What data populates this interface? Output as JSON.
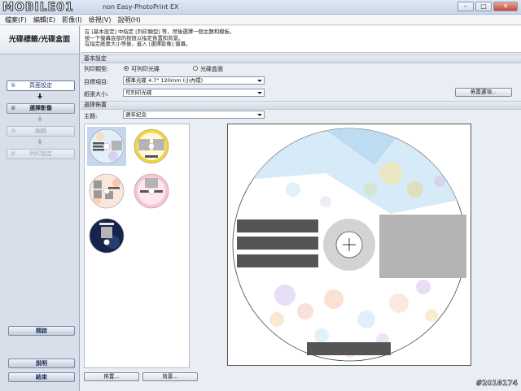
{
  "window": {
    "logo": "MOBILE01",
    "title": "non Easy-PhotoPrint EX",
    "controls": [
      "–",
      "□",
      "✕"
    ]
  },
  "menu": [
    "檔案(F)",
    "編輯(E)",
    "影像(I)",
    "檢視(V)",
    "說明(H)"
  ],
  "sidebar": {
    "title": "光碟標籤/光碟盒面",
    "steps": [
      {
        "num": "①",
        "label": "頁面設定"
      },
      {
        "num": "②",
        "label": "選擇影像"
      },
      {
        "num": "③",
        "label": "編輯"
      },
      {
        "num": "④",
        "label": "列印設定"
      }
    ],
    "open_label": "開啟",
    "help_label": "說明",
    "exit_label": "結束"
  },
  "instructions": [
    "在 [基本設定] 中指定 [列印類型] 等，然後選擇一個主題和模板。",
    "按一下螢幕底部的按鈕以指定佈置和背景。",
    "在指定紙張大小等後，進入 [選擇影像] 螢幕。"
  ],
  "basic": {
    "header": "基本設定",
    "print_type_label": "列印類型:",
    "radio_printable": "可列印光碟",
    "radio_case": "光碟盒面",
    "target_label": "目標項目:",
    "target_value": "標準光碟 4.7\" 120mm (小內環)",
    "paper_label": "紙張大小:",
    "paper_value": "可列印光碟",
    "layout_options_label": "佈置選項..."
  },
  "layout": {
    "header": "選擇佈置",
    "theme_label": "主題:",
    "theme_value": "週年紀念",
    "layout_button": "佈置...",
    "background_button": "背景..."
  },
  "colors": {
    "accent": "#1a3d7c",
    "placeholder_dark": "#555555",
    "placeholder_light": "#b4b4b4"
  },
  "watermark": "#2018174"
}
